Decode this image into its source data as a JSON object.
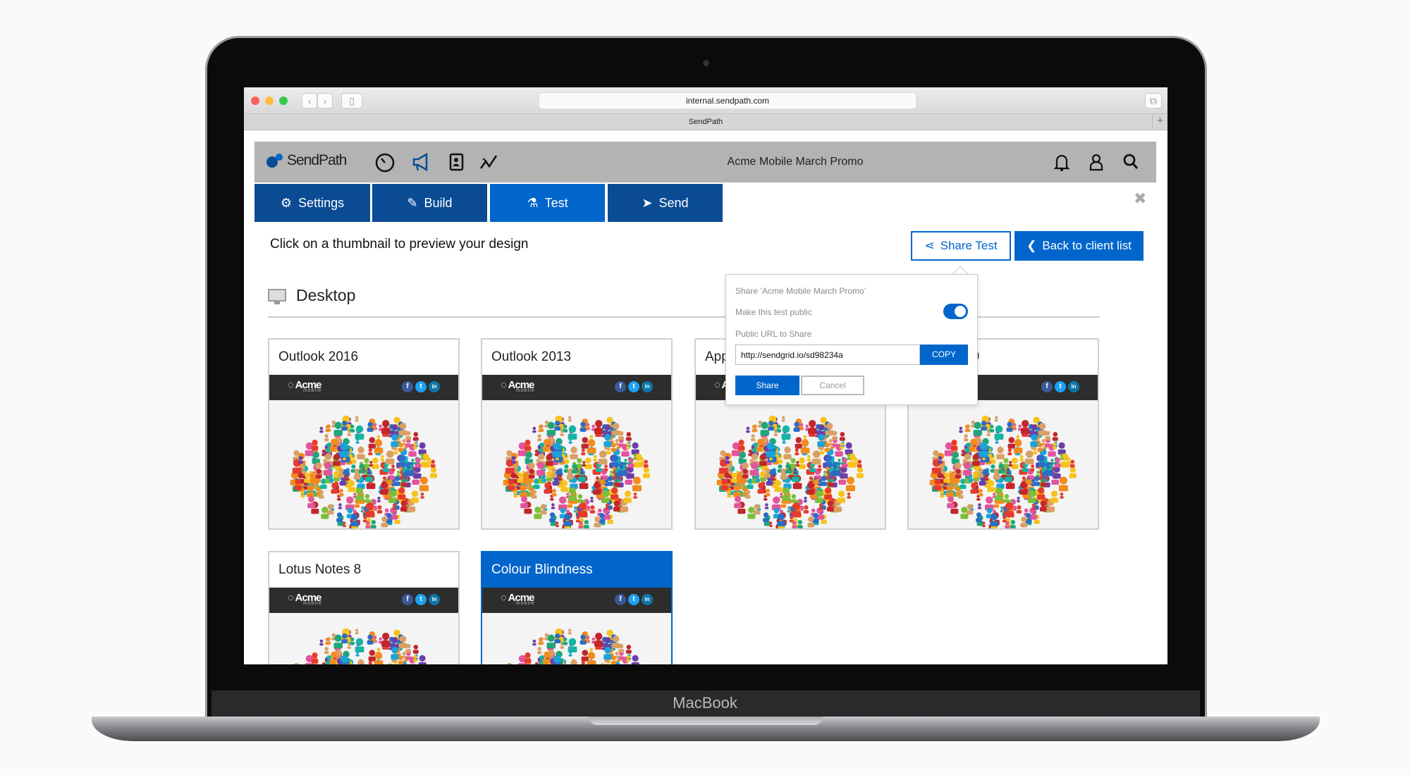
{
  "device": {
    "brand": "MacBook"
  },
  "browser": {
    "url": "internal.sendpath.com",
    "tab_title": "SendPath",
    "new_tab": "+"
  },
  "app": {
    "logo": "SendPath",
    "nav_icons": [
      "dashboard-icon",
      "megaphone-icon",
      "contacts-icon",
      "analytics-icon"
    ],
    "campaign_title": "Acme Mobile March Promo",
    "right_icons": [
      "bell-icon",
      "user-icon",
      "search-icon"
    ]
  },
  "tabs": [
    {
      "label": "Settings",
      "icon": "gears-icon",
      "active": false
    },
    {
      "label": "Build",
      "icon": "pencil-icon",
      "active": false
    },
    {
      "label": "Test",
      "icon": "flask-icon",
      "active": true
    },
    {
      "label": "Send",
      "icon": "paper-plane-icon",
      "active": false
    }
  ],
  "main": {
    "close": "✖",
    "instruction": "Click on a thumbnail to preview your design",
    "share_test_label": "Share Test",
    "back_label": "Back to client list",
    "section_title": "Desktop"
  },
  "cards": [
    {
      "title": "Outlook 2016",
      "selected": false
    },
    {
      "title": "Outlook 2013",
      "selected": false
    },
    {
      "title": "App",
      "selected": false
    },
    {
      "title": "s 9",
      "selected": false
    },
    {
      "title": "Lotus Notes 8",
      "selected": false
    },
    {
      "title": "Colour Blindness",
      "selected": true
    }
  ],
  "email_preview": {
    "brand": "Acme",
    "tagline": "mobile",
    "social": [
      "f",
      "t",
      "in"
    ]
  },
  "share_popup": {
    "title": "Share ‘Acme Mobile March Promo’",
    "public_label": "Make this test public",
    "public_enabled": true,
    "url_label": "Public URL to Share",
    "url_value": "http://sendgrid.io/sd98234a",
    "copy_label": "COPY",
    "share_label": "Share",
    "cancel_label": "Cancel"
  },
  "colors": {
    "primary": "#0066cc",
    "tab_dark": "#0a4b94",
    "header_gray": "#b3b3b3"
  }
}
